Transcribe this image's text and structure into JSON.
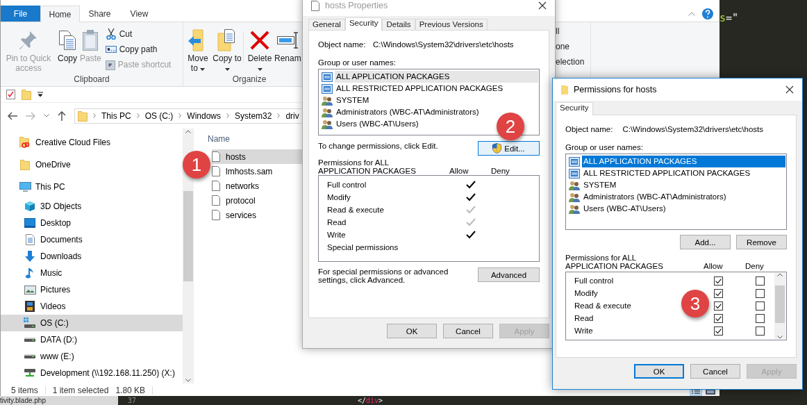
{
  "explorer": {
    "ribbon_tabs": [
      {
        "label": "File",
        "kind": "backstage",
        "selected": false
      },
      {
        "label": "Home",
        "kind": "tab",
        "selected": true
      },
      {
        "label": "Share",
        "kind": "tab",
        "selected": false
      },
      {
        "label": "View",
        "kind": "tab",
        "selected": false
      }
    ],
    "clipboard": {
      "label": "Clipboard",
      "large": [
        {
          "label": "Pin to Quick access",
          "kind": "pin",
          "disabled": true
        },
        {
          "label": "Copy",
          "kind": "copy",
          "disabled": false
        },
        {
          "label": "Paste",
          "kind": "paste",
          "disabled": true
        }
      ],
      "small": [
        {
          "label": "Cut",
          "kind": "cut",
          "disabled": false
        },
        {
          "label": "Copy path",
          "kind": "copy-path",
          "disabled": false
        },
        {
          "label": "Paste shortcut",
          "kind": "paste-shortcut",
          "disabled": true
        }
      ]
    },
    "organize": {
      "label": "Organize",
      "buttons": [
        {
          "label": "Move to",
          "kind": "move",
          "dropdown": true
        },
        {
          "label": "Copy to",
          "kind": "copy-to",
          "dropdown": true
        },
        {
          "label": "Delete",
          "kind": "delete",
          "dropdown": true
        },
        {
          "label": "Renam",
          "kind": "rename",
          "dropdown": false
        }
      ]
    },
    "select_partial": [
      "ll",
      "one",
      "election"
    ],
    "address": [
      "This PC",
      "OS (C:)",
      "Windows",
      "System32",
      "driv"
    ],
    "nav": [
      {
        "label": "Creative Cloud Files",
        "kind": "cloud-folder",
        "selected": false
      },
      {
        "label": "OneDrive",
        "kind": "folder",
        "selected": false
      },
      {
        "label": "This PC",
        "kind": "computer",
        "selected": false,
        "children": [
          {
            "label": "3D Objects",
            "kind": "cube",
            "selected": false
          },
          {
            "label": "Desktop",
            "kind": "desktop",
            "selected": false
          },
          {
            "label": "Documents",
            "kind": "documents",
            "selected": false
          },
          {
            "label": "Downloads",
            "kind": "downloads",
            "selected": false
          },
          {
            "label": "Music",
            "kind": "music",
            "selected": false
          },
          {
            "label": "Pictures",
            "kind": "pictures",
            "selected": false
          },
          {
            "label": "Videos",
            "kind": "videos",
            "selected": false
          },
          {
            "label": "OS (C:)",
            "kind": "system-drive",
            "selected": true
          },
          {
            "label": "DATA (D:)",
            "kind": "drive",
            "selected": false
          },
          {
            "label": "www (E:)",
            "kind": "drive",
            "selected": false
          },
          {
            "label": "Development (\\\\192.168.11.250) (X:)",
            "kind": "network-drive",
            "selected": false
          }
        ]
      }
    ],
    "files": {
      "header": "Name",
      "items": [
        {
          "name": "hosts",
          "selected": true
        },
        {
          "name": "lmhosts.sam",
          "selected": false
        },
        {
          "name": "networks",
          "selected": false
        },
        {
          "name": "protocol",
          "selected": false
        },
        {
          "name": "services",
          "selected": false
        }
      ]
    },
    "status": {
      "count": "5 items",
      "selection": "1 item selected",
      "size": "1.80 KB"
    }
  },
  "properties": {
    "title": "hosts Properties",
    "tabs": [
      {
        "label": "General",
        "selected": false
      },
      {
        "label": "Security",
        "selected": true
      },
      {
        "label": "Details",
        "selected": false
      },
      {
        "label": "Previous Versions",
        "selected": false
      }
    ],
    "object_label": "Object name:",
    "object_name": "C:\\Windows\\System32\\drivers\\etc\\hosts",
    "group_label": "Group or user names:",
    "principals": [
      {
        "name": "ALL APPLICATION PACKAGES",
        "kind": "package",
        "selected": true
      },
      {
        "name": "ALL RESTRICTED APPLICATION PACKAGES",
        "kind": "package",
        "selected": false
      },
      {
        "name": "SYSTEM",
        "kind": "group",
        "selected": false
      },
      {
        "name": "Administrators (WBC-AT\\Administrators)",
        "kind": "group",
        "selected": false
      },
      {
        "name": "Users (WBC-AT\\Users)",
        "kind": "group",
        "selected": false
      }
    ],
    "change_text": "To change permissions, click Edit.",
    "edit_button": "Edit...",
    "permissions_label": "Permissions for ALL APPLICATION PACKAGES",
    "allow_label": "Allow",
    "deny_label": "Deny",
    "permissions": [
      {
        "name": "Full control",
        "allow": true,
        "inherited": false,
        "deny": false
      },
      {
        "name": "Modify",
        "allow": true,
        "inherited": false,
        "deny": false
      },
      {
        "name": "Read & execute",
        "allow": true,
        "inherited": true,
        "deny": false
      },
      {
        "name": "Read",
        "allow": true,
        "inherited": true,
        "deny": false
      },
      {
        "name": "Write",
        "allow": true,
        "inherited": false,
        "deny": false
      },
      {
        "name": "Special permissions",
        "allow": false,
        "inherited": false,
        "deny": false
      }
    ],
    "advanced_text": "For special permissions or advanced settings, click Advanced.",
    "advanced_button": "Advanced",
    "buttons": [
      {
        "label": "OK",
        "disabled": false
      },
      {
        "label": "Cancel",
        "disabled": false
      },
      {
        "label": "Apply",
        "disabled": true
      }
    ]
  },
  "permissions": {
    "title": "Permissions for hosts",
    "tabs": [
      {
        "label": "Security",
        "selected": true
      }
    ],
    "object_label": "Object name:",
    "object_name": "C:\\Windows\\System32\\drivers\\etc\\hosts",
    "group_label": "Group or user names:",
    "principals": [
      {
        "name": "ALL APPLICATION PACKAGES",
        "kind": "package",
        "selected": true
      },
      {
        "name": "ALL RESTRICTED APPLICATION PACKAGES",
        "kind": "package",
        "selected": false
      },
      {
        "name": "SYSTEM",
        "kind": "group",
        "selected": false
      },
      {
        "name": "Administrators (WBC-AT\\Administrators)",
        "kind": "group",
        "selected": false
      },
      {
        "name": "Users (WBC-AT\\Users)",
        "kind": "group",
        "selected": false
      }
    ],
    "add_button": "Add...",
    "remove_button": "Remove",
    "permissions_label": "Permissions for ALL APPLICATION PACKAGES",
    "allow_label": "Allow",
    "deny_label": "Deny",
    "permissions": [
      {
        "name": "Full control",
        "allow": true,
        "deny": false
      },
      {
        "name": "Modify",
        "allow": true,
        "deny": false
      },
      {
        "name": "Read & execute",
        "allow": true,
        "deny": false
      },
      {
        "name": "Read",
        "allow": true,
        "deny": false
      },
      {
        "name": "Write",
        "allow": true,
        "deny": false
      }
    ],
    "buttons": [
      {
        "label": "OK",
        "default": true,
        "disabled": false
      },
      {
        "label": "Cancel",
        "default": false,
        "disabled": false
      },
      {
        "label": "Apply",
        "default": false,
        "disabled": true
      }
    ]
  },
  "callouts": [
    "1",
    "2",
    "3"
  ],
  "editor": {
    "top_code": [
      {
        "text": "s",
        "kind": "attribute"
      },
      {
        "text": "=\"",
        "kind": "plain"
      }
    ],
    "tab": "tivity.blade.php",
    "line_number": "37",
    "bottom_code": [
      {
        "text": "</",
        "kind": "plain"
      },
      {
        "text": "div",
        "kind": "tag"
      },
      {
        "text": ">",
        "kind": "plain"
      }
    ]
  }
}
